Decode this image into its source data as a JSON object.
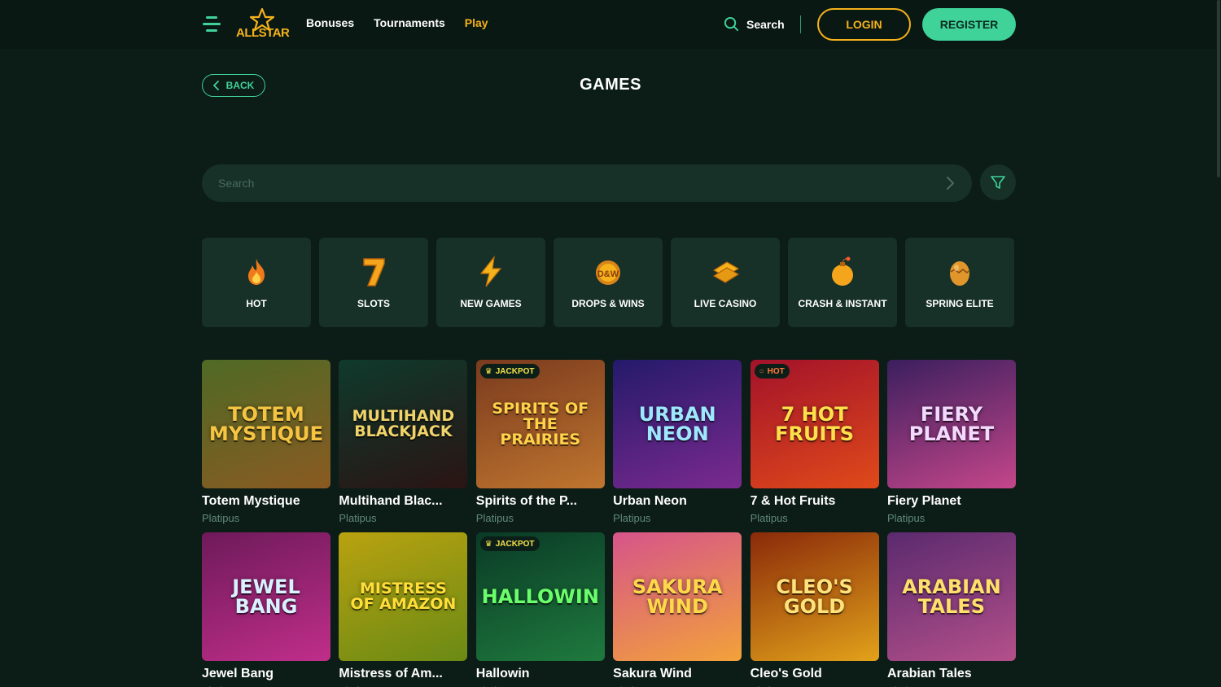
{
  "header": {
    "logo_text": "ALLSTAR",
    "nav": [
      {
        "label": "Bonuses",
        "active": false
      },
      {
        "label": "Tournaments",
        "active": false
      },
      {
        "label": "Play",
        "active": true
      }
    ],
    "search_label": "Search",
    "login_label": "LOGIN",
    "register_label": "REGISTER"
  },
  "page": {
    "back_label": "BACK",
    "title": "GAMES",
    "search_placeholder": "Search"
  },
  "categories": [
    {
      "label": "HOT",
      "icon": "flame-icon"
    },
    {
      "label": "SLOTS",
      "icon": "seven-icon"
    },
    {
      "label": "NEW GAMES",
      "icon": "lightning-icon"
    },
    {
      "label": "DROPS & WINS",
      "icon": "drops-wins-icon"
    },
    {
      "label": "LIVE CASINO",
      "icon": "cards-icon"
    },
    {
      "label": "CRASH & INSTANT",
      "icon": "bomb-icon"
    },
    {
      "label": "SPRING ELITE",
      "icon": "egg-icon"
    }
  ],
  "games": [
    {
      "name": "Totem Mystique",
      "provider": "Platipus",
      "art": "TOTEM MYSTIQUE",
      "badge": "",
      "colors": [
        "#4f6a25",
        "#8a5a22"
      ],
      "text_color": "#f5c542"
    },
    {
      "name": "Multihand Blac...",
      "provider": "Platipus",
      "art": "MULTIHAND BLACKJACK",
      "badge": "",
      "colors": [
        "#0f3a2c",
        "#2a1414"
      ],
      "text_color": "#f0d36a"
    },
    {
      "name": "Spirits of the P...",
      "provider": "Platipus",
      "art": "SPIRITS OF THE PRAIRIES",
      "badge": "JACKPOT",
      "colors": [
        "#7a3a1e",
        "#c0762f"
      ],
      "text_color": "#ffd24a"
    },
    {
      "name": "Urban Neon",
      "provider": "Platipus",
      "art": "URBAN NEON",
      "badge": "",
      "colors": [
        "#241a6b",
        "#7b2a8f"
      ],
      "text_color": "#9ee8ff"
    },
    {
      "name": "7 & Hot Fruits",
      "provider": "Platipus",
      "art": "7 HOT FRUITS",
      "badge": "HOT",
      "colors": [
        "#a3122a",
        "#e04a1a"
      ],
      "text_color": "#ffe04a"
    },
    {
      "name": "Fiery Planet",
      "provider": "Platipus",
      "art": "FIERY PLANET",
      "badge": "",
      "colors": [
        "#3b1f5e",
        "#c4468a"
      ],
      "text_color": "#f4d9ff"
    },
    {
      "name": "Jewel Bang",
      "provider": "Platipus",
      "art": "JEWEL BANG",
      "badge": "",
      "colors": [
        "#6e1a5a",
        "#c02e8a"
      ],
      "text_color": "#d9f2ff"
    },
    {
      "name": "Mistress of Am...",
      "provider": "Platipus",
      "art": "MISTRESS OF AMAZON",
      "badge": "",
      "colors": [
        "#b9a210",
        "#6a8a14"
      ],
      "text_color": "#ffde3a"
    },
    {
      "name": "Hallowin",
      "provider": "Platipus",
      "art": "HALLOWIN",
      "badge": "JACKPOT",
      "colors": [
        "#0a3a26",
        "#1f7a3e"
      ],
      "text_color": "#6aff6a"
    },
    {
      "name": "Sakura Wind",
      "provider": "Platipus",
      "art": "SAKURA WIND",
      "badge": "",
      "colors": [
        "#d6548a",
        "#f2a23a"
      ],
      "text_color": "#ffd84a"
    },
    {
      "name": "Cleo's Gold",
      "provider": "Platipus",
      "art": "CLEO'S GOLD",
      "badge": "",
      "colors": [
        "#8a2a0a",
        "#e2a21a"
      ],
      "text_color": "#ffe27a"
    },
    {
      "name": "Arabian Tales",
      "provider": "Platipus",
      "art": "ARABIAN TALES",
      "badge": "",
      "colors": [
        "#5a2a6e",
        "#b4508a"
      ],
      "text_color": "#ffe06a"
    }
  ],
  "colors": {
    "accent": "#3fd39a",
    "gold": "#f5b21b",
    "background": "#0c1c17",
    "card": "#173128"
  }
}
